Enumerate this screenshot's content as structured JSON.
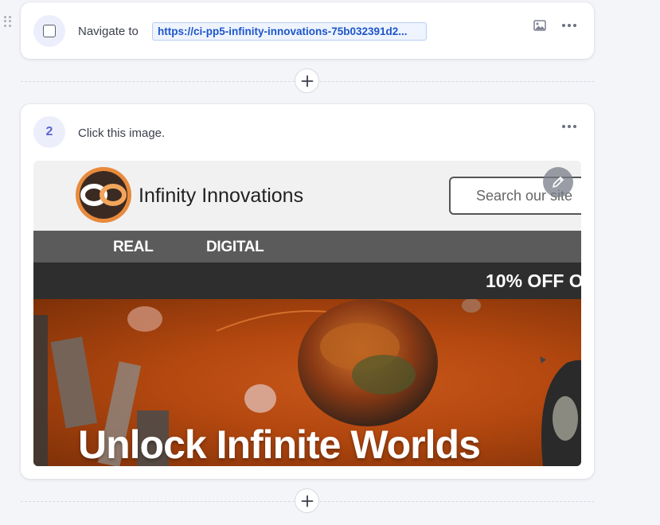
{
  "steps": [
    {
      "icon": "checkbox-icon",
      "text": "Navigate to",
      "url": "https://ci-pp5-infinity-innovations-75b032391d2..."
    },
    {
      "number": "2",
      "text": "Click this image."
    }
  ],
  "screenshot": {
    "brand": "Infinity Innovations",
    "search_placeholder": "Search our site",
    "nav": [
      "REAL",
      "DIGITAL"
    ],
    "promo": "10% OFF O",
    "hero_title": "Unlock Infinite Worlds"
  },
  "icons": {
    "drag": "drag-handle-icon",
    "image": "image-icon",
    "more": "more-options-icon",
    "add": "plus-icon",
    "edit": "pencil-icon"
  },
  "colors": {
    "accent": "#5b63d3",
    "link": "#1d56c9",
    "hero": "#b2470f"
  }
}
